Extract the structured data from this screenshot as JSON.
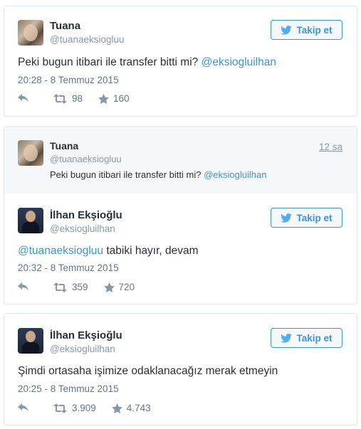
{
  "tweets": [
    {
      "name": "Tuana",
      "handle": "@tuanaeksiogluu",
      "text_plain": "Peki bugun itibari ile transfer bitti mi?",
      "mention": "@eksiogluilhan",
      "time": "20:28 - 8 Temmuz 2015",
      "retweets": "98",
      "favorites": "160",
      "follow_label": "Takip et"
    },
    {
      "reply_to": {
        "name": "Tuana",
        "handle": "@tuanaeksiogluu",
        "ago": "12 sa",
        "text_plain": "Peki bugun itibari ile transfer bitti mi?",
        "mention": "@eksiogluilhan"
      },
      "name": "İlhan Ekşioğlu",
      "handle": "@eksiogluilhan",
      "mention": "@tuanaeksiogluu",
      "text_plain": "tabiki hayır, devam",
      "time": "20:32 - 8 Temmuz 2015",
      "retweets": "359",
      "favorites": "720",
      "follow_label": "Takip et"
    },
    {
      "name": "İlhan Ekşioğlu",
      "handle": "@eksiogluilhan",
      "text_plain": "Şimdi ortasaha işimize odaklanacağız merak etmeyin",
      "time": "20:25 - 8 Temmuz 2015",
      "retweets": "3.909",
      "favorites": "4.743",
      "follow_label": "Takip et"
    }
  ],
  "icons": {
    "reply": "reply-icon",
    "retweet": "retweet-icon",
    "favorite": "star-icon",
    "bird": "twitter-bird-icon"
  },
  "colors": {
    "link": "#3b94d9",
    "muted": "#8899a6",
    "text": "#292f33",
    "border": "#e1e8ed"
  }
}
